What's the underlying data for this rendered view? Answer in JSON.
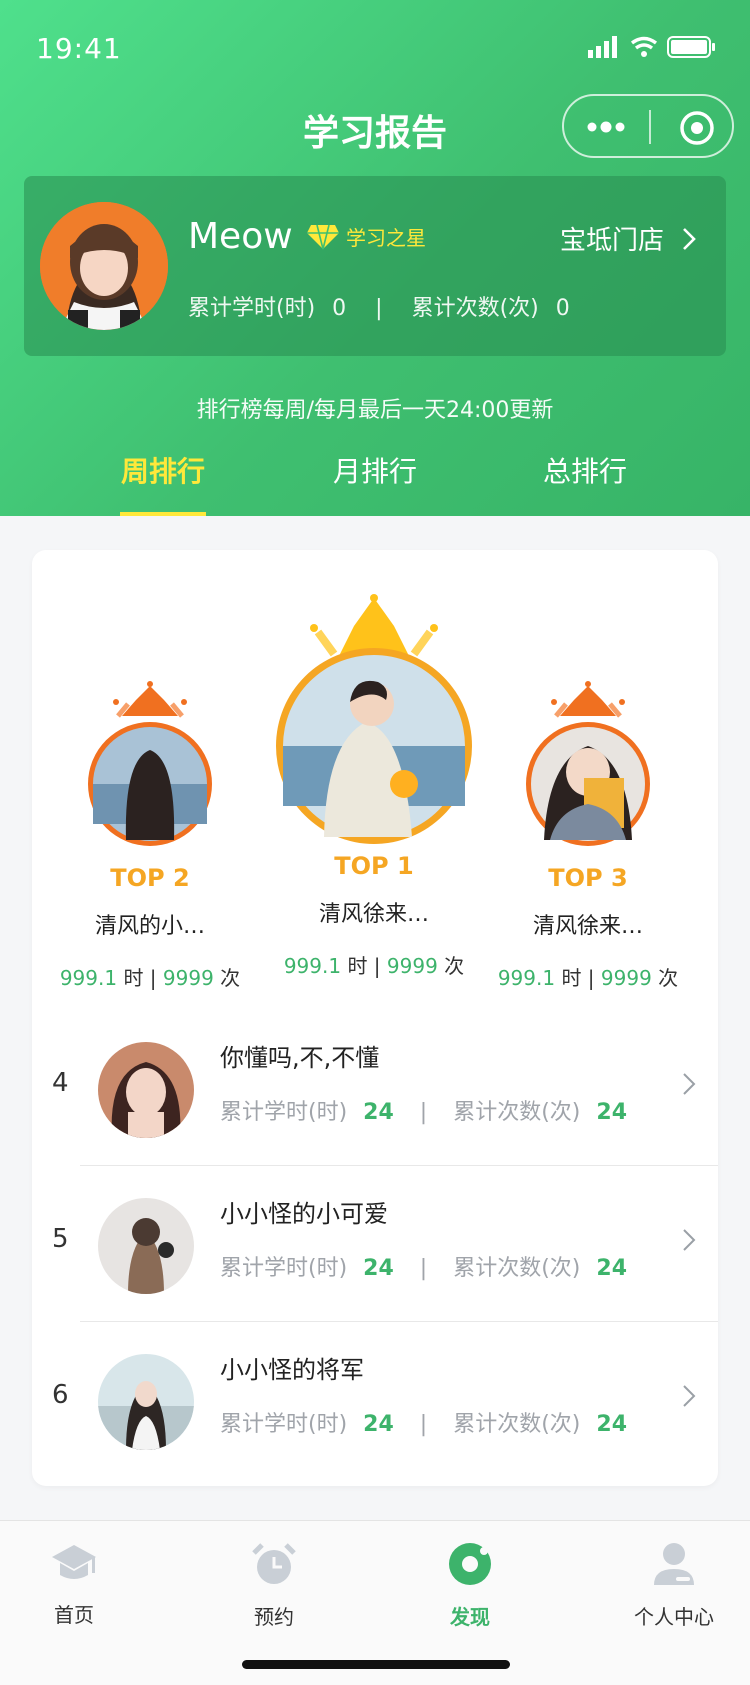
{
  "status": {
    "time": "19:41"
  },
  "nav": {
    "title": "学习报告"
  },
  "user": {
    "name": "Meow",
    "badge_label": "学习之星",
    "store": "宝坻门店",
    "hours_label": "累计学时(时)",
    "hours_value": "0",
    "count_label": "累计次数(次)",
    "count_value": "0"
  },
  "note": "排行榜每周/每月最后一天24:00更新",
  "tabs": [
    {
      "label": "周排行"
    },
    {
      "label": "月排行"
    },
    {
      "label": "总排行"
    }
  ],
  "podium": [
    {
      "top": "TOP 2",
      "name": "清风的小…",
      "hours": "999.1",
      "hours_unit": "时",
      "count": "9999",
      "count_unit": "次"
    },
    {
      "top": "TOP 1",
      "name": "清风徐来…",
      "hours": "999.1",
      "hours_unit": "时",
      "count": "9999",
      "count_unit": "次"
    },
    {
      "top": "TOP 3",
      "name": "清风徐来…",
      "hours": "999.1",
      "hours_unit": "时",
      "count": "9999",
      "count_unit": "次"
    }
  ],
  "list": [
    {
      "rank": "4",
      "name": "你懂吗,不,不懂",
      "hours_label": "累计学时(时)",
      "hours": "24",
      "count_label": "累计次数(次)",
      "count": "24"
    },
    {
      "rank": "5",
      "name": "小小怪的小可爱",
      "hours_label": "累计学时(时)",
      "hours": "24",
      "count_label": "累计次数(次)",
      "count": "24"
    },
    {
      "rank": "6",
      "name": "小小怪的将军",
      "hours_label": "累计学时(时)",
      "hours": "24",
      "count_label": "累计次数(次)",
      "count": "24"
    }
  ],
  "tabbar": [
    {
      "label": "首页",
      "icon": "graduation-cap-icon"
    },
    {
      "label": "预约",
      "icon": "alarm-clock-icon"
    },
    {
      "label": "发现",
      "icon": "discover-icon"
    },
    {
      "label": "个人中心",
      "icon": "person-icon"
    }
  ],
  "colors": {
    "brand_green": "#3db36b",
    "accent_yellow": "#ffe83a",
    "top_orange": "#f5a623"
  }
}
